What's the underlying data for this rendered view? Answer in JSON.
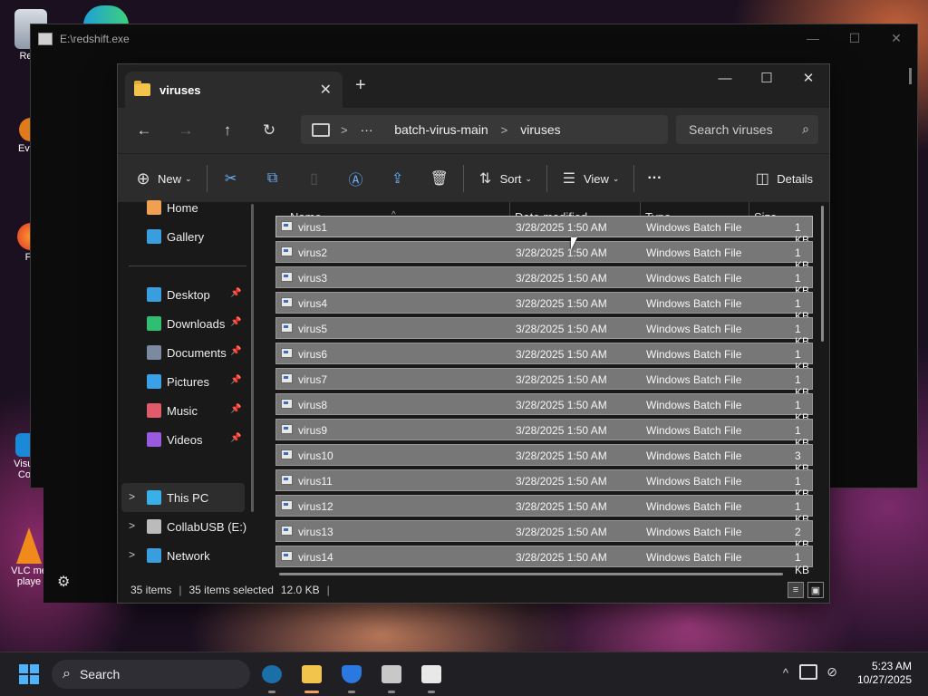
{
  "desktop": {
    "icons": [
      {
        "label": "Recy",
        "name": "recycle-bin"
      },
      {
        "label": "Every",
        "name": "everything"
      },
      {
        "label": "Fir",
        "name": "firefox"
      },
      {
        "label": "Visual",
        "label2": "Cod",
        "name": "vscode"
      },
      {
        "label": "VLC me",
        "label2": "playe",
        "name": "vlc"
      }
    ]
  },
  "console": {
    "title": "E:\\redshift.exe",
    "controls": [
      "—",
      "☐",
      "✕"
    ]
  },
  "explorer": {
    "tab": {
      "label": "viruses",
      "close": "✕"
    },
    "new_tab": "+",
    "window_controls": [
      "—",
      "☐",
      "✕"
    ],
    "nav": {
      "back": "←",
      "forward": "→",
      "up": "↑",
      "refresh": "↻"
    },
    "breadcrumb": {
      "more": "···",
      "items": [
        "batch-virus-main",
        "viruses"
      ],
      "separator": ">"
    },
    "search": {
      "placeholder": "Search viruses"
    },
    "toolbar": {
      "new_label": "New",
      "sort_label": "Sort",
      "view_label": "View",
      "more_label": "···",
      "details_label": "Details"
    },
    "nav_pane": {
      "quick": [
        {
          "label": "Home",
          "icon": "home-icon",
          "color": "#f0a050"
        },
        {
          "label": "Gallery",
          "icon": "gallery-icon",
          "color": "#3a9de0"
        }
      ],
      "pinned": [
        {
          "label": "Desktop",
          "icon": "desktop-icon",
          "color": "#3a9de0"
        },
        {
          "label": "Downloads",
          "icon": "downloads-icon",
          "color": "#2fbf71"
        },
        {
          "label": "Documents",
          "icon": "documents-icon",
          "color": "#7a8ba0"
        },
        {
          "label": "Pictures",
          "icon": "pictures-icon",
          "color": "#3aa0e8"
        },
        {
          "label": "Music",
          "icon": "music-icon",
          "color": "#e05a6a"
        },
        {
          "label": "Videos",
          "icon": "videos-icon",
          "color": "#9a5ae0"
        }
      ],
      "locations": [
        {
          "label": "This PC",
          "icon": "this-pc-icon",
          "color": "#3ab0e8"
        },
        {
          "label": "CollabUSB (E:)",
          "icon": "usb-drive-icon",
          "color": "#bbbbbb"
        },
        {
          "label": "Network",
          "icon": "network-icon",
          "color": "#3a9de0"
        }
      ]
    },
    "columns": {
      "name": "Name",
      "date": "Date modified",
      "type": "Type",
      "size": "Size"
    },
    "files": [
      {
        "name": "virus1",
        "date": "3/28/2025 1:50 AM",
        "type": "Windows Batch File",
        "size": "1 KB"
      },
      {
        "name": "virus2",
        "date": "3/28/2025 1:50 AM",
        "type": "Windows Batch File",
        "size": "1 KB"
      },
      {
        "name": "virus3",
        "date": "3/28/2025 1:50 AM",
        "type": "Windows Batch File",
        "size": "1 KB"
      },
      {
        "name": "virus4",
        "date": "3/28/2025 1:50 AM",
        "type": "Windows Batch File",
        "size": "1 KB"
      },
      {
        "name": "virus5",
        "date": "3/28/2025 1:50 AM",
        "type": "Windows Batch File",
        "size": "1 KB"
      },
      {
        "name": "virus6",
        "date": "3/28/2025 1:50 AM",
        "type": "Windows Batch File",
        "size": "1 KB"
      },
      {
        "name": "virus7",
        "date": "3/28/2025 1:50 AM",
        "type": "Windows Batch File",
        "size": "1 KB"
      },
      {
        "name": "virus8",
        "date": "3/28/2025 1:50 AM",
        "type": "Windows Batch File",
        "size": "1 KB"
      },
      {
        "name": "virus9",
        "date": "3/28/2025 1:50 AM",
        "type": "Windows Batch File",
        "size": "1 KB"
      },
      {
        "name": "virus10",
        "date": "3/28/2025 1:50 AM",
        "type": "Windows Batch File",
        "size": "3 KB"
      },
      {
        "name": "virus11",
        "date": "3/28/2025 1:50 AM",
        "type": "Windows Batch File",
        "size": "1 KB"
      },
      {
        "name": "virus12",
        "date": "3/28/2025 1:50 AM",
        "type": "Windows Batch File",
        "size": "1 KB"
      },
      {
        "name": "virus13",
        "date": "3/28/2025 1:50 AM",
        "type": "Windows Batch File",
        "size": "2 KB"
      },
      {
        "name": "virus14",
        "date": "3/28/2025 1:50 AM",
        "type": "Windows Batch File",
        "size": "1 KB"
      }
    ],
    "status": {
      "count": "35 items",
      "selected": "35 items selected",
      "size": "12.0 KB",
      "pipe": "|"
    }
  },
  "taskbar": {
    "search_label": "Search",
    "apps": [
      {
        "name": "steam-icon",
        "color": "#1b6fa8"
      },
      {
        "name": "file-explorer-icon",
        "color": "#f2c44b",
        "active": true
      },
      {
        "name": "windows-security-icon",
        "color": "#2a78e0"
      },
      {
        "name": "notepad-app-icon",
        "color": "#c8c8c8"
      },
      {
        "name": "console-app-icon",
        "color": "#e8e8e8"
      }
    ],
    "tray": {
      "chevron": "^",
      "time": "5:23 AM",
      "date": "10/27/2025"
    }
  }
}
